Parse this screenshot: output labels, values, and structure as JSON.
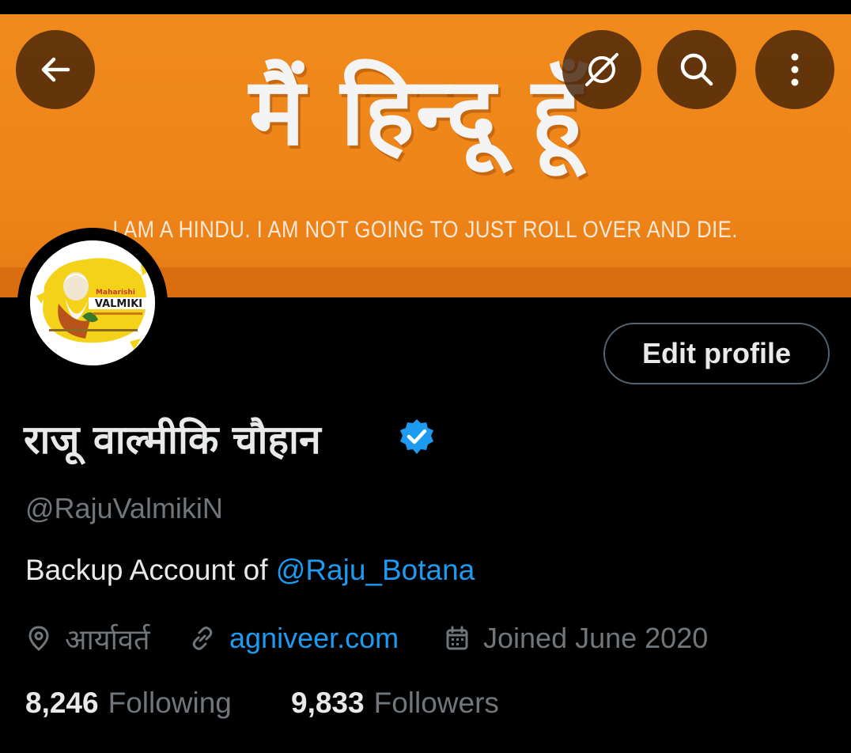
{
  "banner": {
    "hindi_text": "मैं हिन्दू हूँ",
    "english_text": "I AM A HINDU. I AM NOT GOING TO JUST ROLL OVER AND DIE."
  },
  "header_icons": {
    "back": "arrow-left-icon",
    "translate": "globe-strike-icon",
    "search": "search-icon",
    "more": "more-vertical-icon"
  },
  "avatar": {
    "line1": "Maharishi",
    "line2": "VALMIKI"
  },
  "profile": {
    "edit_label": "Edit profile",
    "display_name": "राजू वाल्मीकि चौहान",
    "handle": "@RajuValmikiN",
    "bio_prefix": "Backup Account of ",
    "bio_mention": "@Raju_Botana",
    "location": "आर्यावर्त",
    "website": "agniveer.com",
    "joined": "Joined June 2020",
    "following_count": "8,246",
    "following_label": "Following",
    "followers_count": "9,833",
    "followers_label": "Followers"
  },
  "colors": {
    "accent": "#1d9bf0",
    "banner": "#ee8418",
    "muted": "#71767b"
  }
}
